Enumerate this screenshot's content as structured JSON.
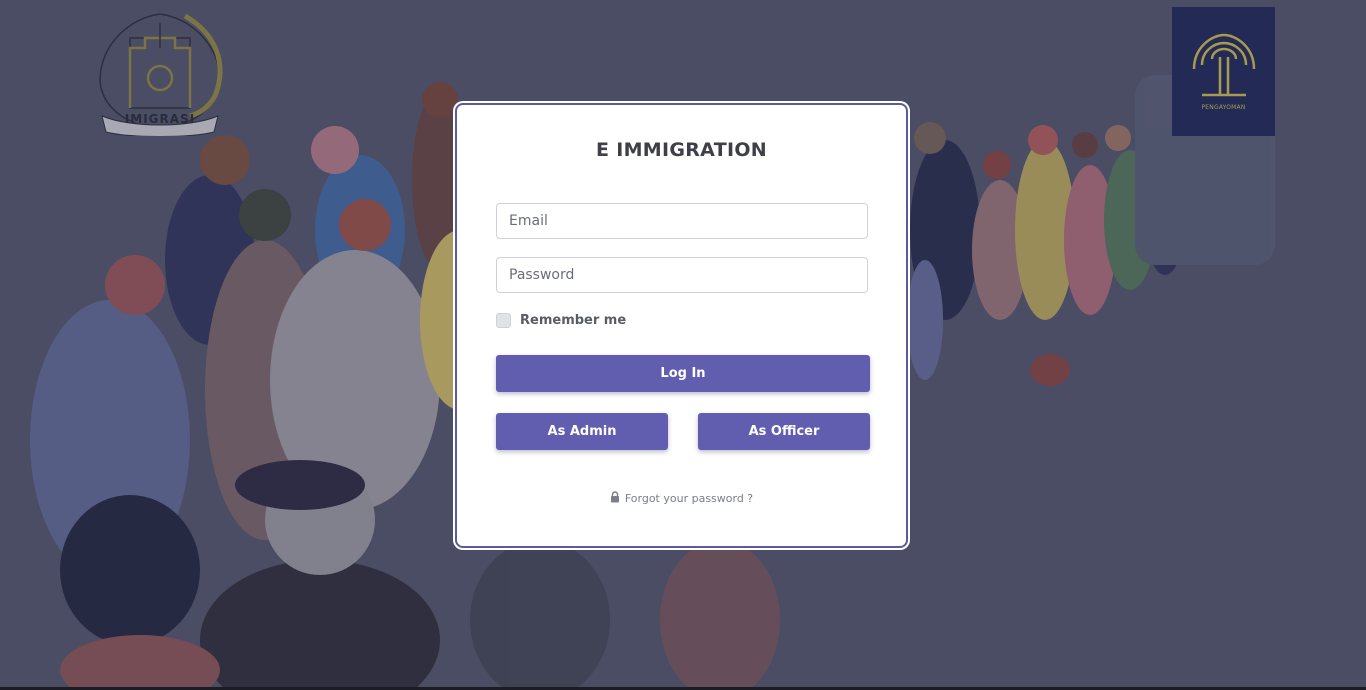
{
  "header": {
    "left_logo_text": "IMIGRASI",
    "right_logo_text": "PENGAYOMAN"
  },
  "login": {
    "title": "E IMMIGRATION",
    "email_placeholder": "Email",
    "password_placeholder": "Password",
    "remember_label": "Remember me",
    "login_label": "Log In",
    "admin_label": "As Admin",
    "officer_label": "As Officer",
    "forgot_label": "Forgot your password ?"
  },
  "icons": {
    "lock": "lock-icon"
  },
  "colors": {
    "background": "#4a4d63",
    "accent": "#615eb0",
    "card_border": "#5b5a9e",
    "right_logo_bg": "#232a55"
  }
}
